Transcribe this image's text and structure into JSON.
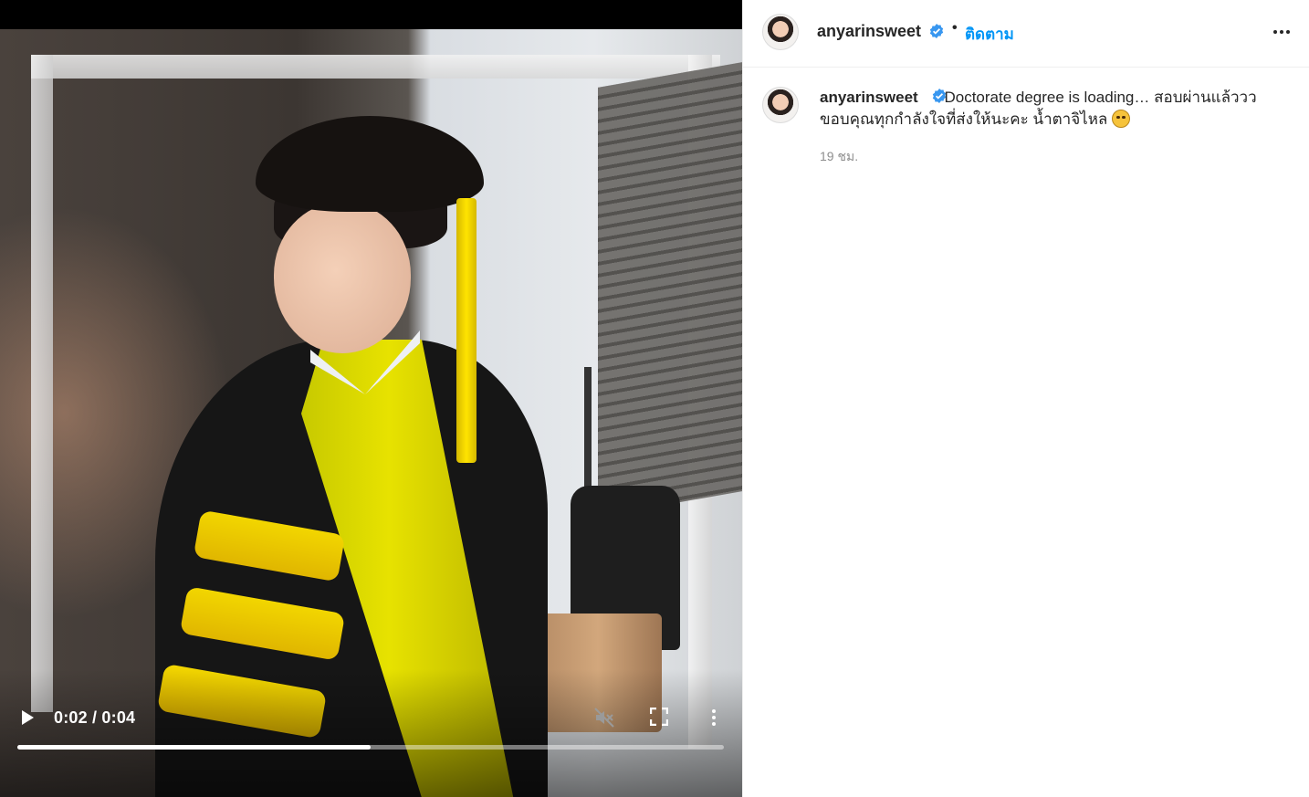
{
  "post": {
    "username": "anyarinsweet",
    "follow_label": "ติดตาม",
    "separator": "•",
    "caption_line1": "Doctorate degree is loading… สอบผ่านแล้ววว",
    "caption_line2": "ขอบคุณทุกกำลังใจที่ส่งให้นะคะ น้ำตาจิไหล",
    "caption_emoji": "pensive-face-emoji",
    "timestamp": "19 ชม."
  },
  "video": {
    "time_display": "0:02 / 0:04",
    "current_seconds": 2,
    "duration_seconds": 4,
    "progress_fraction": 0.5,
    "muted": true
  },
  "icons": {
    "verified": "verified-badge-icon",
    "more": "more-options-icon",
    "play": "play-icon",
    "mute": "muted-speaker-icon",
    "fullscreen": "fullscreen-icon",
    "video_more": "vertical-dots-icon"
  },
  "colors": {
    "link_blue": "#0095f6",
    "verified_blue": "#3897f0",
    "text": "#262626",
    "muted_text": "#8e8e8e"
  }
}
